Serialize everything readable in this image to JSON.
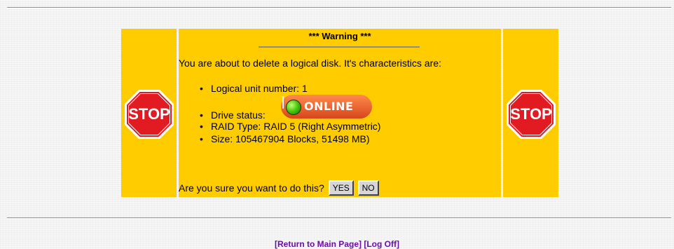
{
  "warning": {
    "title": "*** Warning ***",
    "intro": "You are about to delete a logical disk. It's characteristics are:"
  },
  "disk": {
    "lun": "Logical unit number: 1",
    "status_label": "Drive status:",
    "status_badge": "ONLINE",
    "raid_type": "RAID Type: RAID 5 (Right Asymmetric)",
    "size": "Size: 105467904 Blocks, 51498 MB)"
  },
  "stop_sign": {
    "text": "STOP",
    "color": "#e21b23"
  },
  "confirm": {
    "question": "Are you sure you want to do this?",
    "yes_label": "YES",
    "no_label": "NO"
  },
  "footer": {
    "return_link": "[Return to Main Page]",
    "logoff_link": "[Log Off]"
  },
  "colors": {
    "panel": "#ffcc00",
    "link": "#6a0dad",
    "online_badge": "#1d3fa0"
  }
}
